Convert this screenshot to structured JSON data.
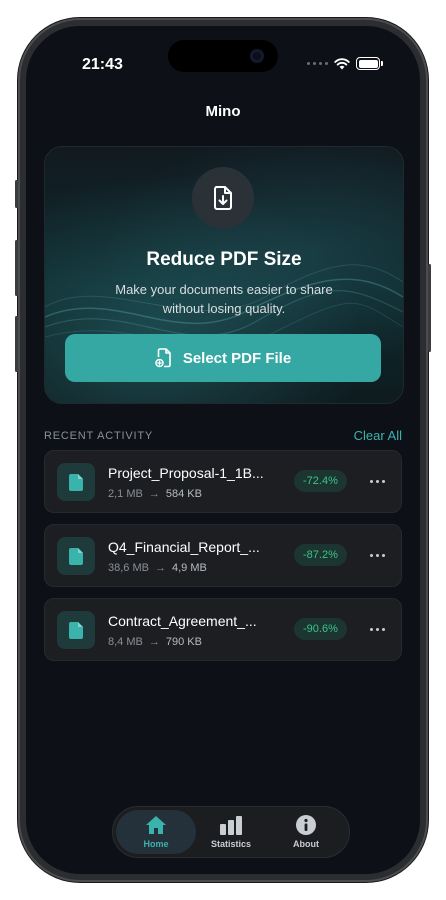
{
  "status_bar": {
    "time": "21:43"
  },
  "app": {
    "title": "Mino"
  },
  "hero": {
    "title": "Reduce PDF Size",
    "subtitle_line1": "Make your documents easier to share",
    "subtitle_line2": "without losing quality.",
    "button_label": "Select PDF File",
    "icon": "file-download-icon"
  },
  "recent": {
    "label": "RECENT ACTIVITY",
    "clear_label": "Clear All",
    "items": [
      {
        "name": "Project_Proposal-1_1B...",
        "original": "2,1 MB",
        "compressed": "584 KB",
        "reduction": "-72.4%"
      },
      {
        "name": "Q4_Financial_Report_...",
        "original": "38,6 MB",
        "compressed": "4,9 MB",
        "reduction": "-87.2%"
      },
      {
        "name": "Contract_Agreement_...",
        "original": "8,4 MB",
        "compressed": "790 KB",
        "reduction": "-90.6%"
      }
    ]
  },
  "tabs": [
    {
      "label": "Home",
      "icon": "home-icon",
      "active": true
    },
    {
      "label": "Statistics",
      "icon": "bar-chart-icon",
      "active": false
    },
    {
      "label": "About",
      "icon": "info-icon",
      "active": false
    }
  ],
  "colors": {
    "accent": "#35a8a4",
    "badge_text": "#3ac48a",
    "background": "#0d1117"
  }
}
